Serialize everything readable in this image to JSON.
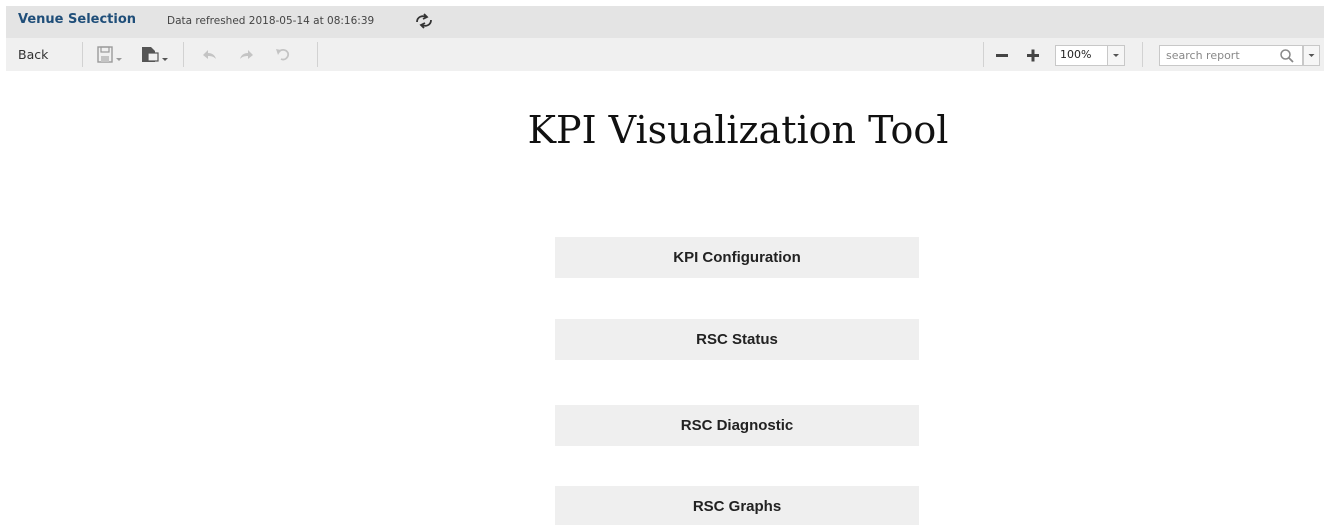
{
  "header": {
    "title": "Venue Selection",
    "refreshed_text": "Data refreshed 2018-05-14 at 08:16:39",
    "refresh_icon": "refresh-icon"
  },
  "toolbar": {
    "back_label": "Back",
    "icons": [
      "save-icon",
      "export-icon",
      "undo-icon",
      "redo-icon",
      "reset-icon",
      "zoom-out-icon",
      "zoom-in-icon",
      "search-icon"
    ],
    "zoom_value": "100%",
    "search_placeholder": "search report"
  },
  "main": {
    "title": "KPI Visualization Tool",
    "buttons": [
      {
        "label": "KPI Configuration"
      },
      {
        "label": "RSC Status"
      },
      {
        "label": "RSC Diagnostic"
      },
      {
        "label": "RSC Graphs"
      }
    ]
  },
  "colors": {
    "header_title": "#1f4e79",
    "header_bg": "#e4e4e4",
    "toolbar_bg": "#f0f0f0",
    "button_bg": "#efefef"
  }
}
